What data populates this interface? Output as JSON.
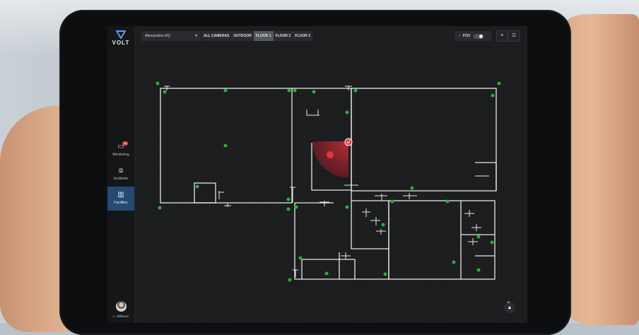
{
  "app": {
    "brand": "VOLT"
  },
  "sidebar": {
    "items": [
      {
        "label": "Monitoring",
        "icon": "monitor-icon",
        "badge": "16"
      },
      {
        "label": "Incidents",
        "icon": "briefcase-icon"
      },
      {
        "label": "Facilities",
        "icon": "building-icon",
        "active": true
      }
    ],
    "user": {
      "name": "L. Williams",
      "icon": "avatar-icon"
    }
  },
  "toolbar": {
    "location": "Alexandria HQ",
    "tabs": [
      {
        "label": "ALL CAMERAS"
      },
      {
        "label": "OUTDOOR"
      },
      {
        "label": "FLOOR 1",
        "selected": true
      },
      {
        "label": "FLOOR 2"
      },
      {
        "label": "FLOOR 3"
      }
    ],
    "fov_label": "FOV",
    "fov_on": true
  },
  "map": {
    "compass_label": "N",
    "camera_color_online": "#22b33a",
    "camera_color_alert": "#e0403c"
  },
  "colors": {
    "accent_active": "#254a72",
    "wall": "#e8e8e8"
  }
}
